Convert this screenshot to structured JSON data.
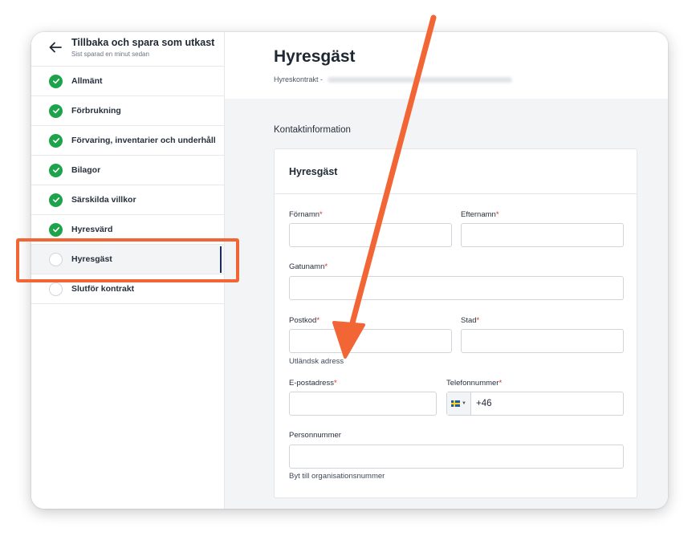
{
  "sidebar": {
    "back": {
      "title": "Tillbaka och spara som utkast",
      "subtitle": "Sist sparad en minut sedan"
    },
    "items": [
      {
        "label": "Allmänt",
        "status": "done"
      },
      {
        "label": "Förbrukning",
        "status": "done"
      },
      {
        "label": "Förvaring, inventarier och underhåll",
        "status": "done"
      },
      {
        "label": "Bilagor",
        "status": "done"
      },
      {
        "label": "Särskilda villkor",
        "status": "done"
      },
      {
        "label": "Hyresvärd",
        "status": "done"
      },
      {
        "label": "Hyresgäst",
        "status": "active"
      },
      {
        "label": "Slutför kontrakt",
        "status": "todo"
      }
    ]
  },
  "header": {
    "title": "Hyresgäst",
    "subtitle": "Hyreskontrakt -"
  },
  "main": {
    "section_title": "Kontaktinformation",
    "card_title": "Hyresgäst",
    "fields": {
      "fornamn": {
        "label": "Förnamn",
        "required": "*",
        "value": ""
      },
      "efternamn": {
        "label": "Efternamn",
        "required": "*",
        "value": ""
      },
      "gatunamn": {
        "label": "Gatunamn",
        "required": "*",
        "value": ""
      },
      "postkod": {
        "label": "Postkod",
        "required": "*",
        "value": ""
      },
      "stad": {
        "label": "Stad",
        "required": "*",
        "value": ""
      },
      "epost": {
        "label": "E-postadress",
        "required": "*",
        "value": ""
      },
      "telefon": {
        "label": "Telefonnummer",
        "required": "*",
        "dial_code": "+46",
        "country_icon": "sweden-flag-icon"
      },
      "personnummer": {
        "label": "Personnummer",
        "value": ""
      }
    },
    "foreign_address_link": "Utländsk adress",
    "org_number_link": "Byt till organisationsnummer"
  },
  "colors": {
    "annotation": "#f26535",
    "check_green": "#1da34a",
    "active_indicator": "#1b2b5c",
    "required_star": "#d92d20"
  }
}
